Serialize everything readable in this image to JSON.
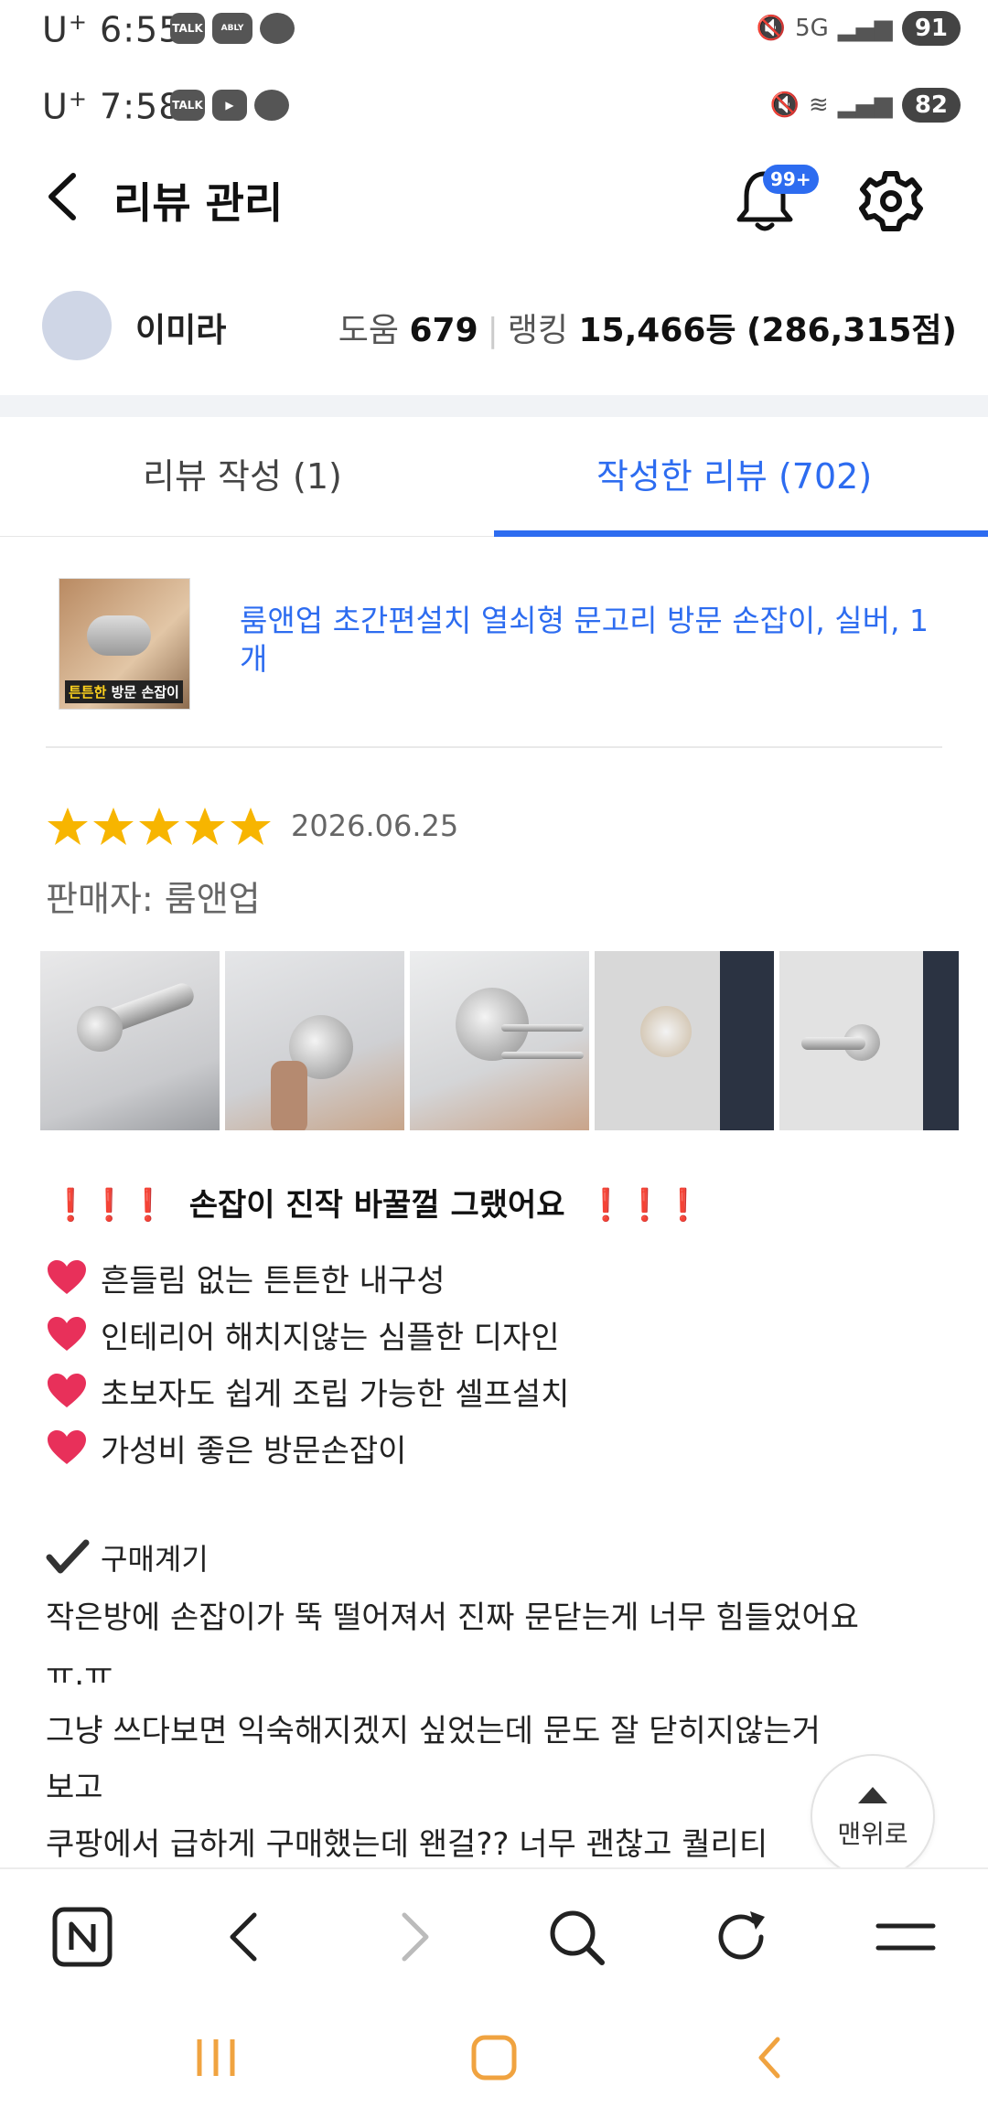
{
  "status_bar_1": {
    "carrier": "U",
    "carrier_sup": "+",
    "time": "6:55",
    "apps": [
      "TALK",
      "ABLY",
      ""
    ],
    "net": "5G",
    "battery": "91"
  },
  "status_bar_2": {
    "carrier": "U",
    "carrier_sup": "+",
    "time": "7:58",
    "apps": [
      "TALK",
      "▶",
      ""
    ],
    "battery": "82"
  },
  "header": {
    "title": "리뷰 관리",
    "notification_badge": "99+",
    "icons": [
      "back-icon",
      "bell-icon",
      "gear-icon"
    ]
  },
  "profile": {
    "name": "이미라",
    "help_label": "도움",
    "help_count": "679",
    "rank_label": "랭킹",
    "rank_value": "15,466등",
    "points": "(286,315점)"
  },
  "tabs": [
    {
      "label": "리뷰 작성 (1)",
      "active": false
    },
    {
      "label": "작성한 리뷰 (702)",
      "active": true
    }
  ],
  "product": {
    "name": "룸앤업 초간편설치 열쇠형 문고리 방문 손잡이, 실버, 1개",
    "thumb_caption_highlight": "튼튼한",
    "thumb_caption_rest": " 방문 손잡이"
  },
  "review": {
    "rating": 5,
    "date": "2026.06.25",
    "seller": "판매자: 룸앤업",
    "photo_count": 5,
    "headline_marks": "❗❗❗",
    "headline": "손잡이 진작 바꿀껄 그랬어요",
    "bullets": [
      "흔들림 없는 튼튼한 내구성",
      "인테리어 해치지않는 심플한 디자인",
      "초보자도 쉽게 조립 가능한 셀프설치",
      "가성비 좋은 방문손잡이"
    ],
    "reason_title": "구매계기",
    "body_lines": [
      "작은방에 손잡이가 뚝 떨어져서 진짜 문닫는게 너무 힘들었어요",
      "ㅠ.ㅠ",
      "그냥 쓰다보면 익숙해지겠지 싶었는데 문도 잘 닫히지않는거",
      "보고",
      "쿠팡에서 급하게 구매했는데 왠걸?? 너무 괜찮고 퀄리티"
    ]
  },
  "scroll_top_label": "맨위로",
  "bottom_nav": [
    "naver-icon",
    "back-arrow-icon",
    "forward-arrow-icon",
    "search-icon",
    "refresh-icon",
    "menu-icon"
  ],
  "colors": {
    "accent": "#2d6cf0",
    "star": "#f7b500",
    "heart": "#e8305a",
    "exclaim": "#e0263a"
  }
}
